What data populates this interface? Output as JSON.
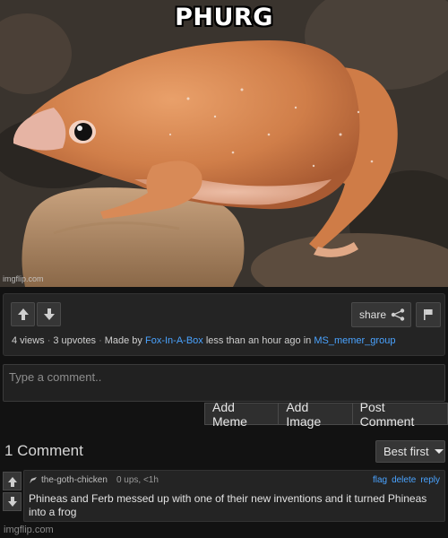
{
  "meme": {
    "caption": "PHURG",
    "watermark": "imgflip.com"
  },
  "post": {
    "upvote_icon": "arrow-up-icon",
    "downvote_icon": "arrow-down-icon",
    "share_label": "share",
    "views": "4 views",
    "upvotes": "3 upvotes",
    "made_by_prefix": "Made by",
    "author": "Fox-In-A-Box",
    "time_text": "less than an hour ago in",
    "stream": "MS_memer_group"
  },
  "composer": {
    "placeholder": "Type a comment..",
    "buttons": [
      "Add Meme",
      "Add Image",
      "Post Comment"
    ]
  },
  "comments_header": {
    "count_label": "1 Comment",
    "sort_label": "Best first"
  },
  "comment": {
    "username": "the-goth-chicken",
    "stats": "0 ups, <1h",
    "actions": [
      "flag",
      "delete",
      "reply"
    ],
    "text": "Phineas and Ferb messed up with one of their new inventions and it turned Phineas into a frog"
  },
  "footer": {
    "watermark": "imgflip.com"
  },
  "colors": {
    "page_bg": "#121212",
    "panel_bg": "#242424",
    "link": "#4aa3ff",
    "frog": "#d98a55"
  }
}
